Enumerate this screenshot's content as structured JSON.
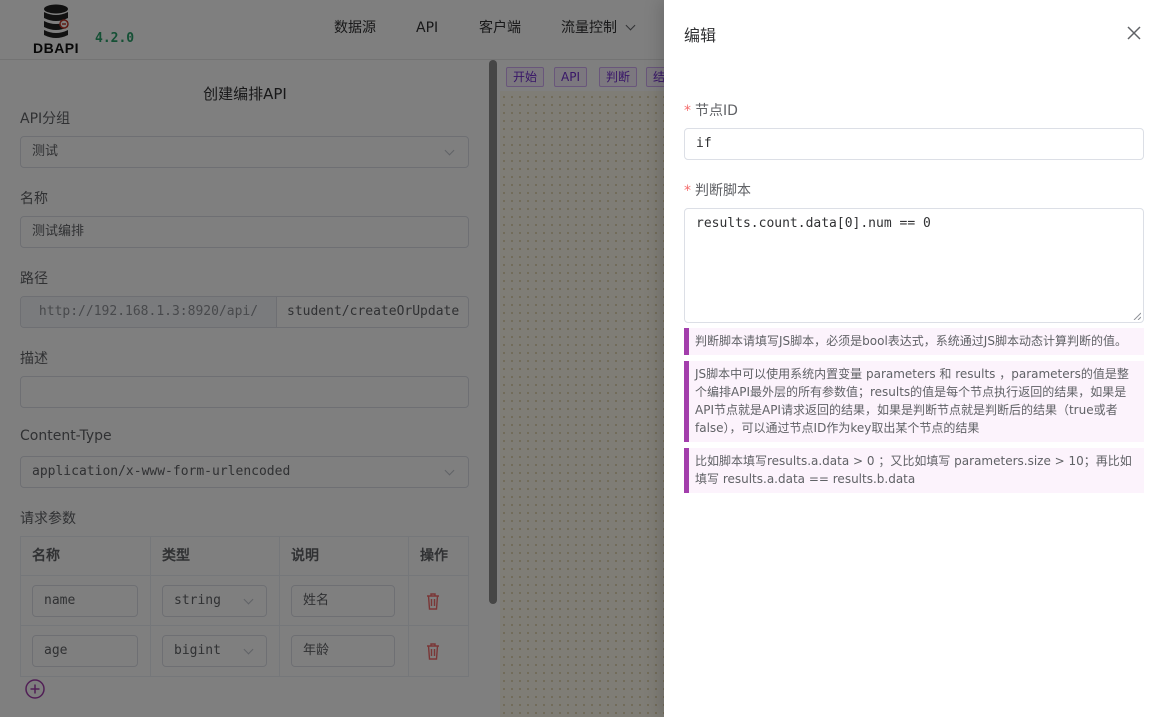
{
  "app": {
    "logo_text": "DBAPI",
    "version": "4.2.0"
  },
  "nav": {
    "items": [
      "数据源",
      "API",
      "客户端",
      "流量控制"
    ]
  },
  "form": {
    "title": "创建编排API",
    "group_label": "API分组",
    "group_value": "测试",
    "name_label": "名称",
    "name_value": "测试编排",
    "path_label": "路径",
    "path_prefix": "http://192.168.1.3:8920/api/",
    "path_value": "student/createOrUpdate",
    "desc_label": "描述",
    "desc_value": "",
    "content_type_label": "Content-Type",
    "content_type_value": "application/x-www-form-urlencoded",
    "params_label": "请求参数",
    "params_headers": [
      "名称",
      "类型",
      "说明",
      "操作"
    ],
    "params": [
      {
        "name": "name",
        "type": "string",
        "desc": "姓名"
      },
      {
        "name": "age",
        "type": "bigint",
        "desc": "年龄"
      }
    ]
  },
  "canvas": {
    "toolbar": [
      "开始",
      "API",
      "判断",
      "结"
    ]
  },
  "drawer": {
    "title": "编辑",
    "node_id_label": "节点ID",
    "node_id_value": "if",
    "script_label": "判断脚本",
    "script_value": "results.count.data[0].num == 0",
    "tips": [
      "判断脚本请填写JS脚本，必须是bool表达式，系统通过JS脚本动态计算判断的值。",
      "JS脚本中可以使用系统内置变量 parameters 和 results ，parameters的值是整个编排API最外层的所有参数值；results的值是每个节点执行返回的结果，如果是API节点就是API请求返回的结果，如果是判断节点就是判断后的结果（true或者false），可以通过节点ID作为key取出某个节点的结果",
      "比如脚本填写results.a.data > 0 ；又比如填写 parameters.size > 10；再比如填写 results.a.data == results.b.data"
    ]
  },
  "colors": {
    "accent": "#a33eac",
    "required": "#f56c6c",
    "danger": "#f56c6c",
    "brand_red": "#c0392b"
  }
}
